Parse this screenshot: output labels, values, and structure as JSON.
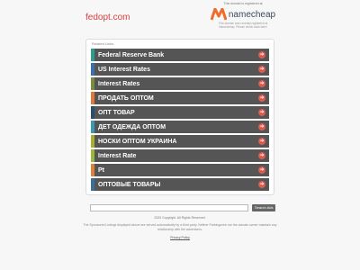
{
  "domain": "fedopt.com",
  "registrar": {
    "registered_at": "This domain is registered at",
    "name": "namecheap",
    "note_line1": "This domain was recently registered at",
    "note_line2": "Namecheap. Please check back later!"
  },
  "related_links": {
    "title": "Related Links",
    "items": [
      {
        "label": "Federal Reserve Bank",
        "color": "#2e9c8e"
      },
      {
        "label": "US Interest Rates",
        "color": "#3a6fb0"
      },
      {
        "label": "Interest Rates",
        "color": "#7c8c3a"
      },
      {
        "label": "ПРОДАТЬ ОПТОМ",
        "color": "#e07a3a"
      },
      {
        "label": "ОПТ ТОВАР",
        "color": "#2a4f6a"
      },
      {
        "label": "ДЕТ ОДЕЖДА ОПТОМ",
        "color": "#3a9ab0"
      },
      {
        "label": "НОСКИ ОПТОМ УКРАИНА",
        "color": "#a8b02e"
      },
      {
        "label": "Interest Rate",
        "color": "#9bb83a"
      },
      {
        "label": "Pt",
        "color": "#e0803a"
      },
      {
        "label": "ОПТОВЫЕ ТОВАРЫ",
        "color": "#3a6f9a"
      }
    ],
    "arrow": "➔"
  },
  "search": {
    "placeholder": "",
    "button": "Search Ads"
  },
  "footer": {
    "copyright": "2020 Copyright. All Rights Reserved.",
    "disclaimer1": "The Sponsored Listings displayed above are served automatically by a third party. Neither Parkingcrew nor the domain owner maintain any",
    "disclaimer2": "relationship with the advertisers.",
    "privacy": "Privacy Policy"
  },
  "colors": {
    "domain": "#d94040",
    "link_bg": "#555555",
    "arrow": "#e05a4e",
    "namecheap_orange": "#f26b2a"
  }
}
